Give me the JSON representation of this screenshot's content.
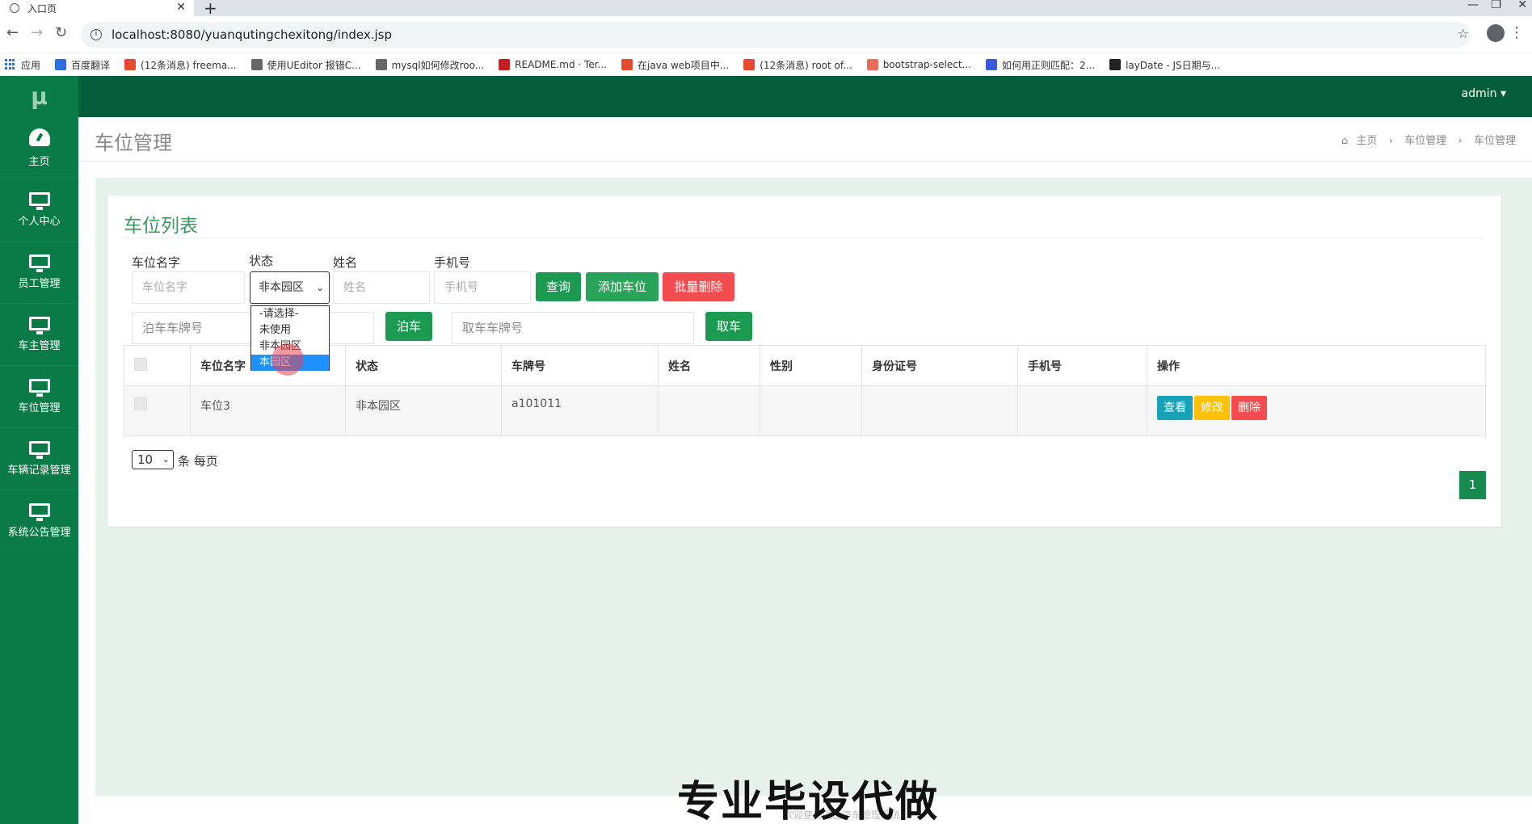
{
  "browser": {
    "tab_title": "入口页",
    "url": "localhost:8080/yuanqutingchexitong/index.jsp",
    "bookmarks": [
      {
        "label": "应用",
        "icon": "apps-icon"
      },
      {
        "label": "百度翻译",
        "icon": "baidu-translate-icon"
      },
      {
        "label": "(12条消息) freema...",
        "icon": "csdn-icon"
      },
      {
        "label": "使用UEditor 报错C...",
        "icon": "bookmark-icon"
      },
      {
        "label": "mysql如何修改roo...",
        "icon": "bookmark-icon"
      },
      {
        "label": "README.md · Ter...",
        "icon": "gitee-icon"
      },
      {
        "label": "在java web项目中...",
        "icon": "csdn-icon"
      },
      {
        "label": "(12条消息) root of...",
        "icon": "csdn-icon"
      },
      {
        "label": "bootstrap-select...",
        "icon": "jianshu-icon"
      },
      {
        "label": "如何用正则匹配：2...",
        "icon": "baidu-icon"
      },
      {
        "label": "layDate - JS日期与...",
        "icon": "laydate-icon"
      }
    ]
  },
  "app": {
    "logo": "μ",
    "user": "admin ▾",
    "sidebar": [
      {
        "label": "主页",
        "icon": "dashboard-icon"
      },
      {
        "label": "个人中心",
        "icon": "monitor-icon"
      },
      {
        "label": "员工管理",
        "icon": "monitor-icon"
      },
      {
        "label": "车主管理",
        "icon": "monitor-icon"
      },
      {
        "label": "车位管理",
        "icon": "monitor-icon"
      },
      {
        "label": "车辆记录管理",
        "icon": "monitor-icon"
      },
      {
        "label": "系统公告管理",
        "icon": "monitor-icon"
      }
    ],
    "page_title": "车位管理",
    "breadcrumb": [
      "主页",
      "车位管理",
      "车位管理"
    ],
    "footer": "欢迎使用园区停车管理系统"
  },
  "card": {
    "title": "车位列表",
    "filters": {
      "name_label": "车位名字",
      "name_placeholder": "车位名字",
      "status_label": "状态",
      "status_value": "非本园区",
      "person_label": "姓名",
      "person_placeholder": "姓名",
      "phone_label": "手机号",
      "phone_placeholder": "手机号"
    },
    "buttons": {
      "query": "查询",
      "add": "添加车位",
      "batch_delete": "批量删除",
      "park": "泊车",
      "pickup": "取车"
    },
    "park_placeholder": "泊车车牌号",
    "pickup_placeholder": "取车车牌号",
    "status_options": [
      "-请选择-",
      "未使用",
      "非本园区",
      "本园区"
    ],
    "status_selected_index": 3,
    "table": {
      "headers": [
        "",
        "车位名字",
        "状态",
        "车牌号",
        "姓名",
        "性别",
        "身份证号",
        "手机号",
        "操作"
      ],
      "rows": [
        {
          "name": "车位3",
          "status": "非本园区",
          "plate": "a101011",
          "person": "",
          "gender": "",
          "idcard": "",
          "phone": ""
        }
      ],
      "actions": {
        "view": "查看",
        "edit": "修改",
        "delete": "删除"
      }
    },
    "pagination": {
      "per_page": "10",
      "per_page_label": "条 每页",
      "current_page": "1"
    }
  },
  "overlay": {
    "watermark": "专业毕设代做"
  },
  "colors": {
    "header": "#055e3b",
    "sidebar": "#0a7a46",
    "accent": "#2aa35a",
    "danger": "#f34d4f"
  }
}
